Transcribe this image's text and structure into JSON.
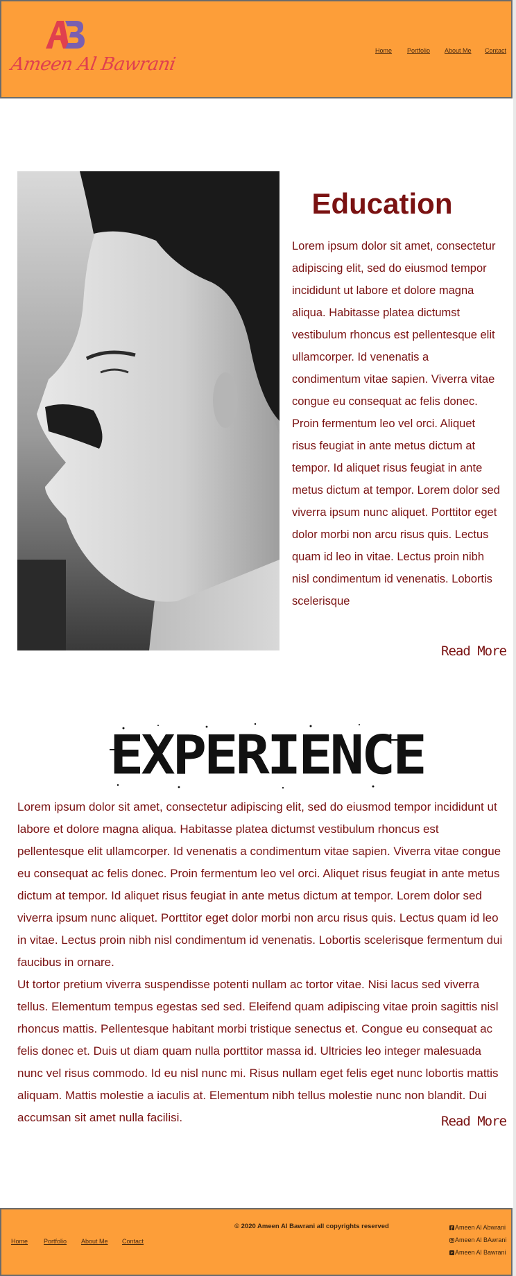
{
  "header": {
    "logo_text": "Ameen Al Bawrani",
    "nav": [
      "Home",
      "Portfolio",
      "About Me",
      "Contact"
    ]
  },
  "education": {
    "title": "Education",
    "body": "Lorem ipsum dolor sit amet, consectetur adipiscing elit, sed do eiusmod tempor incididunt ut labore et dolore magna aliqua. Habitasse platea dictumst vestibulum rhoncus est pellentesque elit ullamcorper. Id venenatis a condimentum vitae sapien. Viverra vitae congue eu consequat ac felis donec. Proin fermentum leo vel orci. Aliquet risus feugiat in ante metus dictum at tempor. Id aliquet risus feugiat in ante metus dictum at tempor. Lorem dolor sed viverra ipsum nunc aliquet. Porttitor eget dolor morbi non arcu risus quis. Lectus quam id leo in vitae. Lectus proin nibh nisl condimentum id venenatis. Lobortis scelerisque",
    "read_more": "Read More"
  },
  "experience": {
    "title": "EXPERIENCE",
    "paragraph1": "Lorem ipsum dolor sit amet, consectetur adipiscing elit, sed do eiusmod tempor incididunt ut labore et dolore magna aliqua. Habitasse platea dictumst vestibulum rhoncus est pellentesque elit ullamcorper. Id venenatis a condimentum vitae sapien. Viverra vitae congue eu consequat ac felis donec. Proin fermentum leo vel orci. Aliquet risus feugiat in ante metus dictum at tempor. Id aliquet risus feugiat in ante metus dictum at tempor. Lorem dolor sed viverra ipsum nunc aliquet. Porttitor eget dolor morbi non arcu risus quis. Lectus quam id leo in vitae. Lectus proin nibh nisl condimentum id venenatis. Lobortis scelerisque fermentum dui faucibus in ornare.",
    "paragraph2": "Ut tortor pretium viverra suspendisse potenti nullam ac tortor vitae. Nisi lacus sed viverra tellus. Elementum tempus egestas sed sed. Eleifend quam adipiscing vitae proin sagittis nisl rhoncus mattis. Pellentesque habitant morbi tristique senectus et. Congue eu consequat ac felis donec et. Duis ut diam quam nulla porttitor massa id. Ultricies leo integer malesuada nunc vel risus commodo. Id eu nisl nunc mi. Risus nullam eget felis eget nunc lobortis mattis aliquam. Mattis molestie a iaculis at. Elementum nibh tellus molestie nunc non blandit. Dui accumsan sit amet nulla facilisi.",
    "read_more": "Read More"
  },
  "footer": {
    "copyright": "© 2020 Ameen Al Bawrani all copyrights reserved",
    "nav": [
      "Home",
      "Portfolio",
      "About Me",
      "Contact"
    ],
    "social": [
      {
        "icon": "facebook-icon",
        "label": "Ameen Al Abwrani"
      },
      {
        "icon": "instagram-icon",
        "label": "Ameen Al BAwrani"
      },
      {
        "icon": "youtube-icon",
        "label": "Ameen Al Bawrani"
      }
    ]
  },
  "colors": {
    "header_bg": "#fd9e39",
    "accent_text": "#7a1212",
    "logo": "#e0404e"
  }
}
